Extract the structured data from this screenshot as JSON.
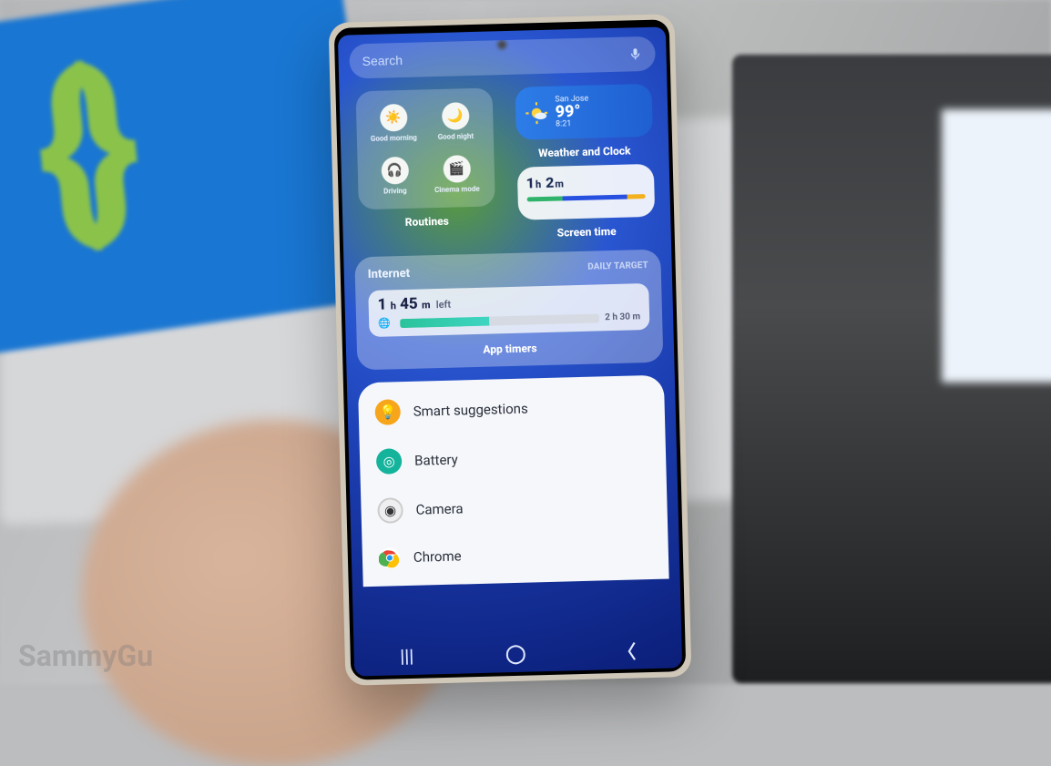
{
  "watermark": "SammyGu",
  "search": {
    "placeholder": "Search"
  },
  "routines": {
    "label": "Routines",
    "items": [
      {
        "name": "Good morning",
        "emoji": "☀️"
      },
      {
        "name": "Good night",
        "emoji": "🌙"
      },
      {
        "name": "Driving",
        "emoji": "🎧"
      },
      {
        "name": "Cinema mode",
        "emoji": "🎬"
      }
    ]
  },
  "weather": {
    "label": "Weather and Clock",
    "location": "San Jose",
    "temp": "99°",
    "time": "8:21"
  },
  "screentime": {
    "label": "Screen time",
    "hours": "1",
    "h_unit": "h",
    "minutes": "2",
    "m_unit": "m"
  },
  "apptimers": {
    "header": "Internet",
    "sub": "DAILY TARGET",
    "left_h": "1",
    "h_unit": "h",
    "left_m": "45",
    "m_unit": "m",
    "left_label": "left",
    "total": "2 h 30 m",
    "caption": "App timers"
  },
  "suggestions": [
    {
      "label": "Smart suggestions",
      "icon": "ss"
    },
    {
      "label": "Battery",
      "icon": "ba"
    },
    {
      "label": "Camera",
      "icon": "ca"
    },
    {
      "label": "Chrome",
      "icon": "ch"
    }
  ]
}
